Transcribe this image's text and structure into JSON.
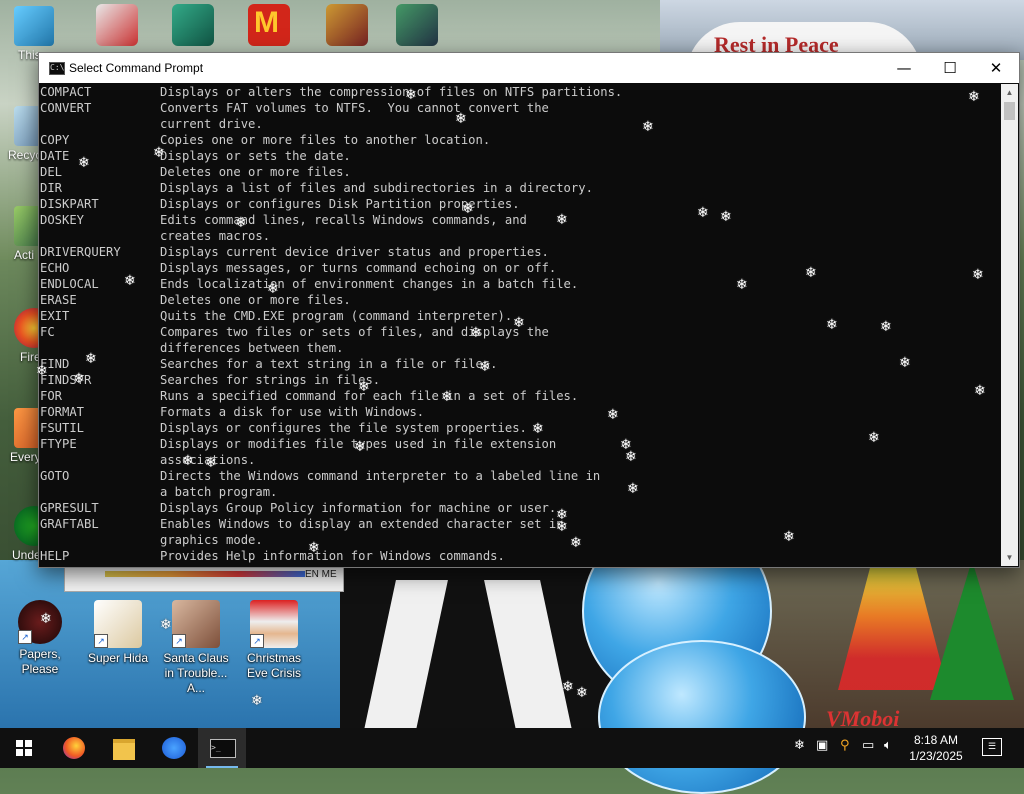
{
  "window": {
    "title": "Select Command Prompt",
    "icon": "cmd-icon",
    "min_label": "—",
    "max_label": "☐",
    "close_label": "✕"
  },
  "console_lines": [
    {
      "cmd": "COMPACT",
      "desc": "Displays or alters the compression of files on NTFS partitions."
    },
    {
      "cmd": "CONVERT",
      "desc": "Converts FAT volumes to NTFS.  You cannot convert the"
    },
    {
      "cmd": "",
      "desc": "current drive."
    },
    {
      "cmd": "COPY",
      "desc": "Copies one or more files to another location."
    },
    {
      "cmd": "DATE",
      "desc": "Displays or sets the date."
    },
    {
      "cmd": "DEL",
      "desc": "Deletes one or more files."
    },
    {
      "cmd": "DIR",
      "desc": "Displays a list of files and subdirectories in a directory."
    },
    {
      "cmd": "DISKPART",
      "desc": "Displays or configures Disk Partition properties."
    },
    {
      "cmd": "DOSKEY",
      "desc": "Edits command lines, recalls Windows commands, and"
    },
    {
      "cmd": "",
      "desc": "creates macros."
    },
    {
      "cmd": "DRIVERQUERY",
      "desc": "Displays current device driver status and properties."
    },
    {
      "cmd": "ECHO",
      "desc": "Displays messages, or turns command echoing on or off."
    },
    {
      "cmd": "ENDLOCAL",
      "desc": "Ends localization of environment changes in a batch file."
    },
    {
      "cmd": "ERASE",
      "desc": "Deletes one or more files."
    },
    {
      "cmd": "EXIT",
      "desc": "Quits the CMD.EXE program (command interpreter)."
    },
    {
      "cmd": "FC",
      "desc": "Compares two files or sets of files, and displays the"
    },
    {
      "cmd": "",
      "desc": "differences between them."
    },
    {
      "cmd": "FIND",
      "desc": "Searches for a text string in a file or files."
    },
    {
      "cmd": "FINDSTR",
      "desc": "Searches for strings in files."
    },
    {
      "cmd": "FOR",
      "desc": "Runs a specified command for each file in a set of files."
    },
    {
      "cmd": "FORMAT",
      "desc": "Formats a disk for use with Windows."
    },
    {
      "cmd": "FSUTIL",
      "desc": "Displays or configures the file system properties."
    },
    {
      "cmd": "FTYPE",
      "desc": "Displays or modifies file types used in file extension"
    },
    {
      "cmd": "",
      "desc": "associations."
    },
    {
      "cmd": "GOTO",
      "desc": "Directs the Windows command interpreter to a labeled line in"
    },
    {
      "cmd": "",
      "desc": "a batch program."
    },
    {
      "cmd": "GPRESULT",
      "desc": "Displays Group Policy information for machine or user."
    },
    {
      "cmd": "GRAFTABL",
      "desc": "Enables Windows to display an extended character set in"
    },
    {
      "cmd": "",
      "desc": "graphics mode."
    },
    {
      "cmd": "HELP",
      "desc": "Provides Help information for Windows commands."
    }
  ],
  "desktop": {
    "left_icons": [
      {
        "label": "This",
        "icon": "this-pc-icon"
      },
      {
        "label": "Recyc",
        "icon": "recycle-bin-icon"
      },
      {
        "label": "Acti",
        "icon": "activity-icon"
      },
      {
        "label": "Fire",
        "icon": "firefox-icon"
      },
      {
        "label": "Every",
        "icon": "everything-icon"
      },
      {
        "label": "Unde",
        "icon": "undertale-icon"
      }
    ],
    "bottom_icons": [
      {
        "label": "Papers, Please",
        "icon": "papers-please-icon"
      },
      {
        "label": "Super Hida",
        "icon": "super-hida-icon"
      },
      {
        "label": "Santa Claus in Trouble... A...",
        "icon": "santa-claus-icon"
      },
      {
        "label": "Christmas Eve Crisis",
        "icon": "christmas-eve-icon"
      }
    ],
    "background_sign": "Rest in Peace",
    "background_logo": "VMoboi",
    "small_window_text": "EN ME"
  },
  "taskbar": {
    "apps": [
      {
        "name": "start",
        "icon": "windows-start-icon"
      },
      {
        "name": "firefox",
        "icon": "firefox-icon"
      },
      {
        "name": "file-explorer",
        "icon": "folder-icon"
      },
      {
        "name": "people",
        "icon": "people-icon"
      },
      {
        "name": "command-prompt",
        "icon": "cmd-icon"
      }
    ],
    "time": "8:18 AM",
    "date": "1/23/2025"
  },
  "colors": {
    "console_bg": "#0c0c0c",
    "console_text": "#cccccc",
    "taskbar_bg": "#101010",
    "accent": "#76b9ed"
  }
}
